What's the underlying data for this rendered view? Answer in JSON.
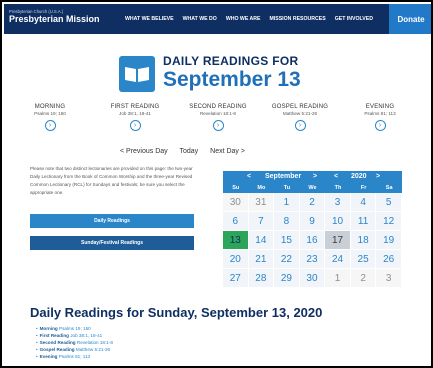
{
  "header": {
    "org_small": "Presbyterian Church (U.S.A.)",
    "org_main": "Presbyterian Mission",
    "nav": [
      "WHAT WE BELIEVE",
      "WHAT WE DO",
      "WHO WE ARE",
      "MISSION RESOURCES",
      "GET INVOLVED"
    ],
    "donate": "Donate"
  },
  "title": {
    "small": "DAILY READINGS FOR",
    "big": "September 13",
    "icon": "open-book-icon"
  },
  "readings": [
    {
      "label": "MORNING",
      "ref": "Psalms 19; 150"
    },
    {
      "label": "FIRST READING",
      "ref": "Job 38:1, 18-41"
    },
    {
      "label": "SECOND READING",
      "ref": "Revelation 18:1-8"
    },
    {
      "label": "GOSPEL READING",
      "ref": "Matthew 5:21-26"
    },
    {
      "label": "EVENING",
      "ref": "Psalms 81; 113"
    }
  ],
  "daynav": {
    "prev": "< Previous Day",
    "today": "Today",
    "next": "Next Day >"
  },
  "note": "Please note that two distinct lectionaries are provided on this page: the two-year Daily Lectionary from the Book of Common Worship and the three-year Revised Common Lectionary (RCL) for Sundays and festivals; be sure you select the appropriate one.",
  "buttons": {
    "daily": "Daily Readings",
    "sunday": "Sunday/Festival Readings"
  },
  "calendar": {
    "prev_month": "<",
    "month": "September",
    "next_month": ">",
    "prev_year": "<",
    "year": "2020",
    "next_year": ">",
    "weekdays": [
      "Su",
      "Mo",
      "Tu",
      "We",
      "Th",
      "Fr",
      "Sa"
    ],
    "days": [
      "30",
      "31",
      "1",
      "2",
      "3",
      "4",
      "5",
      "6",
      "7",
      "8",
      "9",
      "10",
      "11",
      "12",
      "13",
      "14",
      "15",
      "16",
      "17",
      "18",
      "19",
      "20",
      "21",
      "22",
      "23",
      "24",
      "25",
      "26",
      "27",
      "28",
      "29",
      "30",
      "1",
      "2",
      "3"
    ],
    "other_month_days": [
      0,
      1,
      32,
      33,
      34
    ],
    "selected_index": 14,
    "today_index": 18,
    "colors": {
      "accent": "#2a86c9",
      "selected": "#2aa55a",
      "today": "#c9cfd6",
      "navy": "#0f2f63"
    }
  },
  "section_title": "Daily Readings for Sunday, September 13, 2020",
  "list": [
    {
      "label": "Morning",
      "ref": "Psalms 19; 150"
    },
    {
      "label": "First Reading",
      "ref": "Job 38:1, 18-41"
    },
    {
      "label": "Second Reading",
      "ref": "Revelation 18:1-8"
    },
    {
      "label": "Gospel Reading",
      "ref": "Matthew 5:21-26"
    },
    {
      "label": "Evening",
      "ref": "Psalms 81; 113"
    }
  ]
}
